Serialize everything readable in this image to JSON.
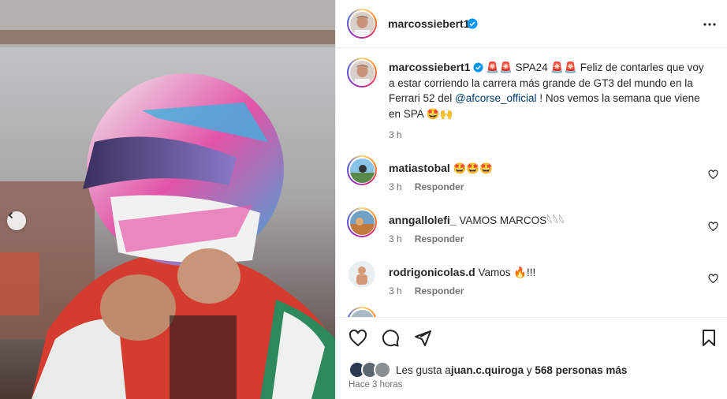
{
  "post": {
    "username": "marcossiebert1",
    "caption_parts": {
      "user": "marcossiebert1",
      "pre": "🚨🚨 SPA24 🚨🚨 Feliz de contarles que voy a estar corriendo la carrera más grande de GT3 del mundo en la Ferrari 52 del ",
      "mention": "@afcorse_official",
      "post": " ! Nos vemos la semana que viene en SPA 🤩🙌"
    },
    "caption_time": "3 h"
  },
  "comments": [
    {
      "user": "matiastobal",
      "text": "🤩🤩🤩",
      "time": "3 h",
      "reply": "Responder"
    },
    {
      "user": "anngallolefi_",
      "text": "VAMOS MARCOS𓆩𓆩𓆩",
      "time": "3 h",
      "reply": "Responder"
    },
    {
      "user": "rodrigonicolas.d",
      "text": "Vamos 🔥!!!",
      "time": "3 h",
      "reply": "Responder"
    }
  ],
  "likes": {
    "prefix": "Les gusta a ",
    "user": "juan.c.quiroga",
    "mid": " y ",
    "count": "568 personas más"
  },
  "timestamp": "Hace 3 horas",
  "icons": {
    "more": "more-horizontal-icon",
    "like": "heart-icon",
    "comment": "comment-icon",
    "share": "share-icon",
    "save": "bookmark-icon",
    "prev": "chevron-left-icon",
    "verified": "verified-badge-icon"
  },
  "colors": {
    "mention": "#00376b",
    "verified": "#0095f6",
    "muted": "#737373"
  }
}
